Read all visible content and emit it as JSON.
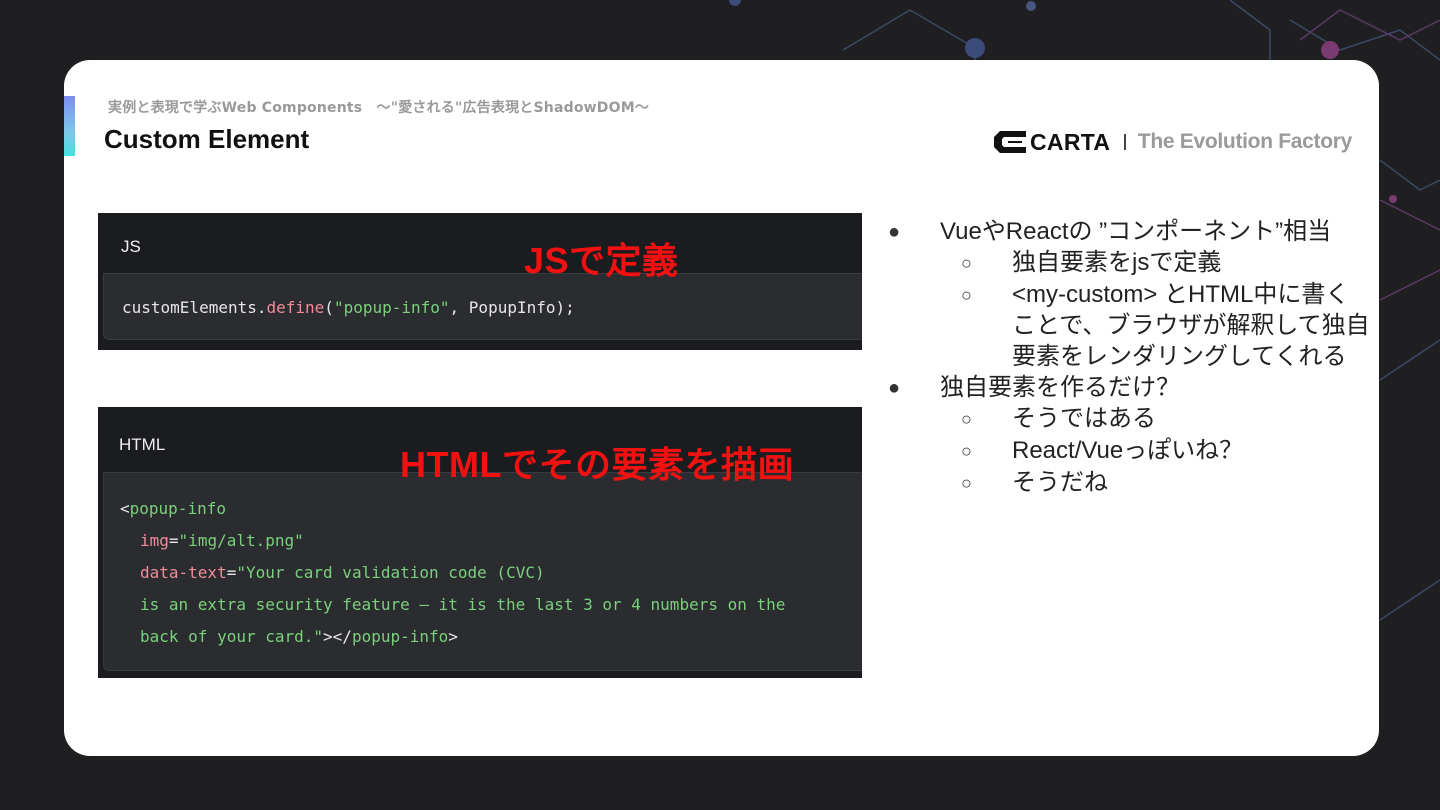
{
  "slide": {
    "subtitle": "実例と表現で学ぶWeb Components　〜\"愛される\"広告表現とShadowDOM〜",
    "title": "Custom Element"
  },
  "brand": {
    "name": "CARTA",
    "tagline": "The Evolution Factory"
  },
  "js_panel": {
    "header": "JS",
    "overlay": "JSで定義",
    "code": {
      "obj": "customElements.",
      "method": "define",
      "open": "(",
      "arg1": "\"popup-info\"",
      "rest": ", PopupInfo);"
    }
  },
  "html_panel": {
    "header": "HTML",
    "overlay": "HTMLでその要素を描画",
    "code": {
      "l1_lt": "<",
      "l1_tag": "popup-info",
      "l2_attr": "img",
      "l2_eq": "=",
      "l2_val": "\"img/alt.png\"",
      "l3_attr": "data-text",
      "l3_eq": "=",
      "l3_val": "\"Your card validation code (CVC)",
      "l4_val": "is an extra security feature — it is the last 3 or 4 numbers on the",
      "l5_val": "back of your card.\"",
      "l5_close1": "></",
      "l5_tag": "popup-info",
      "l5_close2": ">"
    }
  },
  "bullets": {
    "b1": "VueやReactの ”コンポーネント”相当",
    "b1_s1": "独自要素をjsで定義",
    "b1_s2_l1": "<my-custom> とHTML中に書く",
    "b1_s2_l2": "ことで、ブラウザが解釈して独自",
    "b1_s2_l3": "要素をレンダリングしてくれる",
    "b2": "独自要素を作るだけ？",
    "b2_s1": "そうではある",
    "b2_s2": "React/Vueっぽいね？",
    "b2_s3": "そうだね",
    "bullet_mark": "●",
    "sub_mark": "○"
  },
  "colors": {
    "background": "#1f1f21",
    "card": "#ffffff",
    "overlay_red": "#f21111",
    "code_string": "#79d17b",
    "code_keyword": "#f38b9a"
  }
}
